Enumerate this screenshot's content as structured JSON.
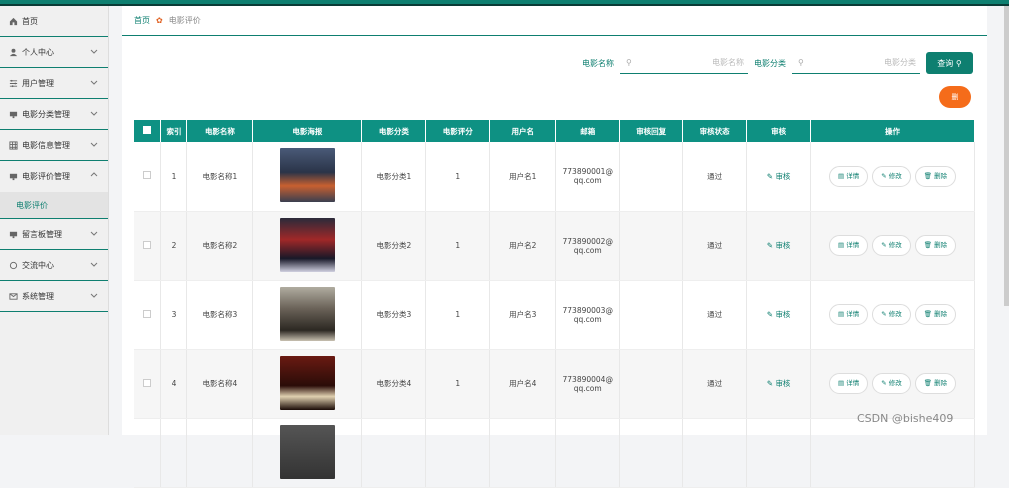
{
  "colors": {
    "accent": "#0e7f70",
    "header_bg": "#0e9183",
    "delete": "#f56c1a"
  },
  "sidebar": {
    "items": [
      {
        "label": "首页",
        "icon": "home-icon"
      },
      {
        "label": "个人中心",
        "icon": "user-icon"
      },
      {
        "label": "用户管理",
        "icon": "sliders-icon"
      },
      {
        "label": "电影分类管理",
        "icon": "film-icon"
      },
      {
        "label": "电影信息管理",
        "icon": "grid-icon"
      },
      {
        "label": "电影评价管理",
        "icon": "film-icon"
      },
      {
        "label": "留言板管理",
        "icon": "film-icon"
      },
      {
        "label": "交流中心",
        "icon": "refresh-icon"
      },
      {
        "label": "系统管理",
        "icon": "mail-icon"
      }
    ],
    "sub_item": "电影评价"
  },
  "breadcrumb": {
    "home": "首页",
    "current": "电影评价"
  },
  "search": {
    "name_label": "电影名称",
    "name_placeholder": "电影名称",
    "category_label": "电影分类",
    "category_placeholder": "电影分类",
    "button": "查询"
  },
  "delete_button": "删",
  "table": {
    "headers": [
      "索引",
      "电影名称",
      "电影海报",
      "电影分类",
      "电影评分",
      "用户名",
      "邮箱",
      "审核回复",
      "审核状态",
      "审核",
      "操作"
    ],
    "rows": [
      {
        "index": "1",
        "name": "电影名称1",
        "category": "电影分类1",
        "score": "1",
        "user": "用户名1",
        "email1": "773890001@",
        "email2": "qq.com",
        "status": "通过"
      },
      {
        "index": "2",
        "name": "电影名称2",
        "category": "电影分类2",
        "score": "1",
        "user": "用户名2",
        "email1": "773890002@",
        "email2": "qq.com",
        "status": "通过"
      },
      {
        "index": "3",
        "name": "电影名称3",
        "category": "电影分类3",
        "score": "1",
        "user": "用户名3",
        "email1": "773890003@",
        "email2": "qq.com",
        "status": "通过"
      },
      {
        "index": "4",
        "name": "电影名称4",
        "category": "电影分类4",
        "score": "1",
        "user": "用户名4",
        "email1": "773890004@",
        "email2": "qq.com",
        "status": "通过"
      }
    ],
    "audit_label": "审核",
    "detail_label": "详情",
    "edit_label": "修改",
    "delete_label": "删除"
  },
  "watermark": "CSDN @bishe409"
}
